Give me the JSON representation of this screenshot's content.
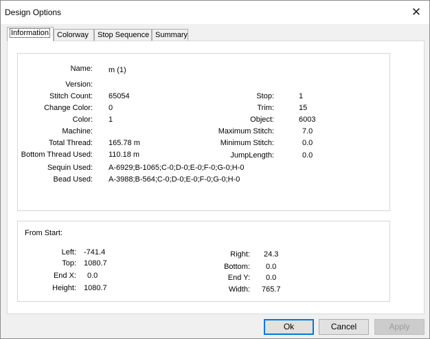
{
  "window": {
    "title": "Design Options"
  },
  "tabs": [
    {
      "label": "Information",
      "active": true
    },
    {
      "label": "Colorway",
      "active": false
    },
    {
      "label": "Stop Sequence",
      "active": false
    },
    {
      "label": "Summary",
      "active": false
    }
  ],
  "info": {
    "name_label": "Name:",
    "name_value": "m (1)",
    "version_label": "Version:",
    "version_value": "",
    "stitch_count_label": "Stitch Count:",
    "stitch_count_value": "65054",
    "change_color_label": "Change Color:",
    "change_color_value": "0",
    "color_label": "Color:",
    "color_value": "1",
    "machine_label": "Machine:",
    "machine_value": "",
    "total_thread_label": "Total Thread:",
    "total_thread_value": "165.78 m",
    "bottom_thread_label": "Bottom Thread Used:",
    "bottom_thread_value": "110.18 m",
    "sequin_label": "Sequin Used:",
    "sequin_value": "A-6929;B-1065;C-0;D-0;E-0;F-0;G-0;H-0",
    "bead_label": "Bead Used:",
    "bead_value": "A-3988;B-564;C-0;D-0;E-0;F-0;G-0;H-0",
    "stop_label": "Stop:",
    "stop_value": "1",
    "trim_label": "Trim:",
    "trim_value": "15",
    "object_label": "Object:",
    "object_value": "6003",
    "max_stitch_label": "Maximum Stitch:",
    "max_stitch_value": "7.0",
    "min_stitch_label": "Minimum Stitch:",
    "min_stitch_value": "0.0",
    "jump_label": "JumpLength:",
    "jump_value": "0.0"
  },
  "from_start": {
    "heading": "From Start:",
    "left_label": "Left:",
    "left_value": "-741.4",
    "top_label": "Top:",
    "top_value": "1080.7",
    "endx_label": "End X:",
    "endx_value": "0.0",
    "height_label": "Height:",
    "height_value": "1080.7",
    "right_label": "Right:",
    "right_value": "24.3",
    "bottom_label": "Bottom:",
    "bottom_value": "0.0",
    "endy_label": "End Y:",
    "endy_value": "0.0",
    "width_label": "Width:",
    "width_value": "765.7"
  },
  "buttons": {
    "ok": "Ok",
    "cancel": "Cancel",
    "apply": "Apply"
  },
  "colors": {
    "accent": "#0078d7",
    "background": "#f0f0f0"
  }
}
